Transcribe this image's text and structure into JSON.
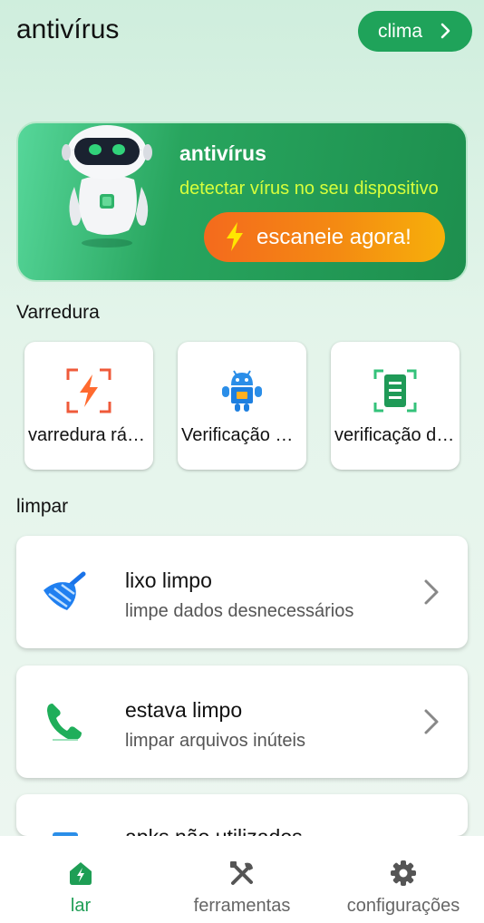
{
  "header": {
    "title": "antivírus",
    "weather_button": "clima"
  },
  "banner": {
    "title": "antivírus",
    "subtitle": "detectar vírus no seu dispositivo",
    "scan_button": "escaneie agora!"
  },
  "scan_section": {
    "label": "Varredura",
    "tiles": [
      {
        "label": "varredura rápida",
        "icon": "quick-scan-icon"
      },
      {
        "label": "Verificação de aplicativos",
        "icon": "android-icon"
      },
      {
        "label": "verificação de arquivos",
        "icon": "file-scan-icon"
      }
    ]
  },
  "clean_section": {
    "label": "limpar",
    "cards": [
      {
        "title": "lixo limpo",
        "subtitle": "limpe dados desnecessários",
        "icon": "broom-icon"
      },
      {
        "title": "estava limpo",
        "subtitle": "limpar arquivos inúteis",
        "icon": "phone-icon"
      },
      {
        "title": "apks não utilizados",
        "subtitle": "",
        "icon": "apk-icon"
      }
    ]
  },
  "bottom_nav": {
    "items": [
      {
        "label": "lar",
        "icon": "home-icon",
        "active": true
      },
      {
        "label": "ferramentas",
        "icon": "tools-icon",
        "active": false
      },
      {
        "label": "configurações",
        "icon": "gear-icon",
        "active": false
      }
    ]
  },
  "colors": {
    "accent": "#1fa35a",
    "banner_subtitle": "#d7ff3b",
    "scan_button_start": "#f46a1d",
    "scan_button_end": "#f7b00a",
    "nav_active": "#1e9e55",
    "nav_inactive": "#666666"
  }
}
